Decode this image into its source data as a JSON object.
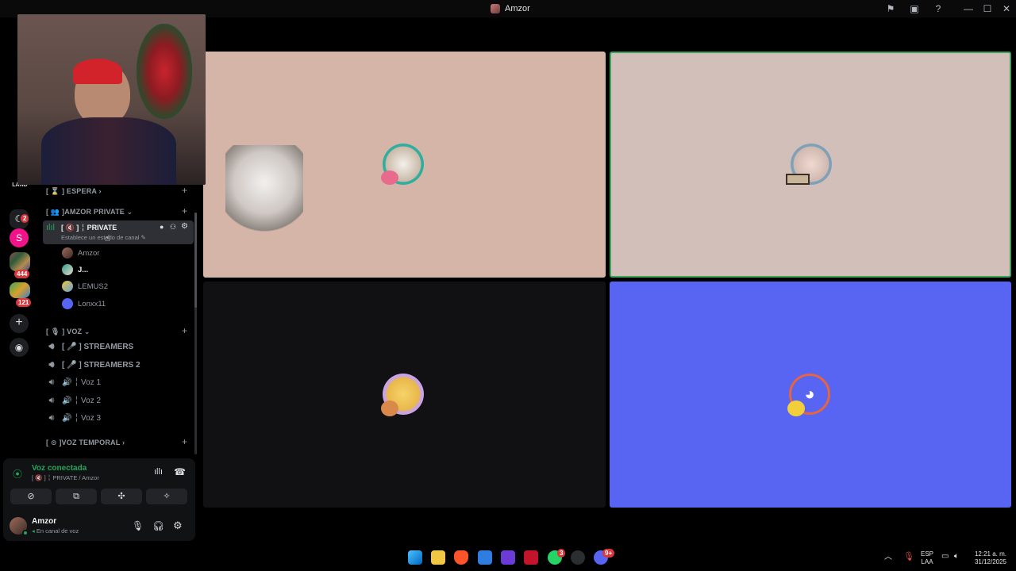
{
  "window": {
    "title": "Amzor"
  },
  "rail": {
    "badges": [
      "2",
      "444",
      "121"
    ],
    "pink_server_letter": "S"
  },
  "sidebar": {
    "categories": {
      "espera": "[ ⌛ ] ESPERA",
      "amzor_private": "[ 👥 ]AMZOR PRIVATE",
      "voz": "[ 🎙 ] VOZ",
      "voz_temporal": "[ ⊙ ]VOZ TEMPORAL"
    },
    "active_channel": {
      "name": "[ 🔇 ] ╎ PRIVATE",
      "status_placeholder": "Establece un estado de canal"
    },
    "members": [
      {
        "name": "Amzor"
      },
      {
        "name": "J..."
      },
      {
        "name": "LEMUS2"
      },
      {
        "name": "Lonxx11"
      }
    ],
    "voice_channels": [
      {
        "name": "[ 🎤 ] STREAMERS"
      },
      {
        "name": "[ 🎤 ] STREAMERS 2"
      },
      {
        "name": "🔊 ╎ Voz 1"
      },
      {
        "name": "🔊 ╎ Voz 2"
      },
      {
        "name": "🔊 ╎ Voz 3"
      }
    ]
  },
  "voice_panel": {
    "status": "Voz conectada",
    "location": "[ 🔇 ] ╎ PRIVATE / Amzor"
  },
  "user_panel": {
    "username": "Amzor",
    "status": "En canal de voz"
  },
  "taskbar": {
    "lang_top": "ESP",
    "lang_bottom": "LAA",
    "time": "12:21 a. m.",
    "date": "31/12/2025",
    "whatsapp_badge": "3",
    "discord_badge": "9+"
  },
  "colors": {
    "connected_green": "#23a55a",
    "tile_speaking_border": "#3ba55d",
    "blurple": "#5865f2"
  }
}
